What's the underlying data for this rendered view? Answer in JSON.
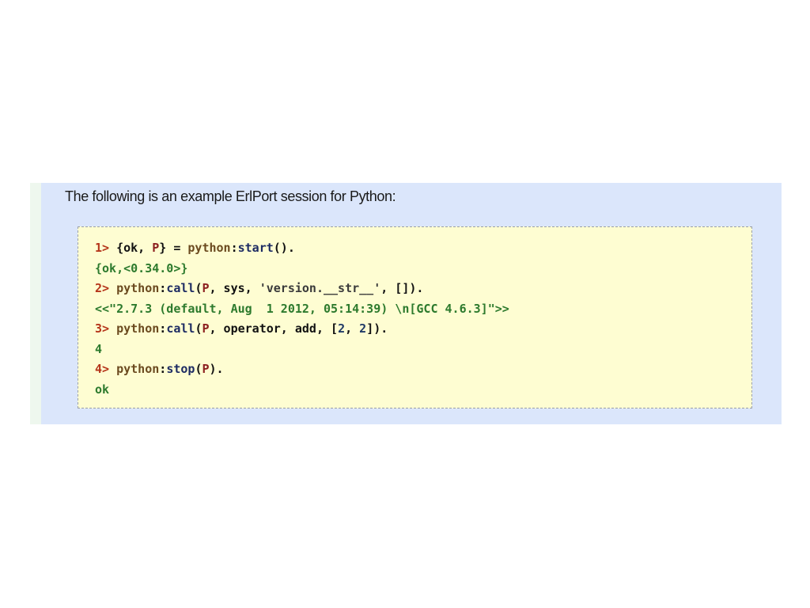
{
  "intro": "The following is an example ErlPort session for Python:",
  "session": {
    "l1": {
      "prompt": "1>",
      "a": "{ok, ",
      "b": "P",
      "c": "} = ",
      "d": "python",
      "e": ":",
      "f": "start",
      "g": "()."
    },
    "o1": "{ok,<0.34.0>}",
    "l2": {
      "prompt": "2>",
      "a": "python",
      "b": ":",
      "c": "call",
      "d": "(",
      "e": "P",
      "f": ", sys, ",
      "g": "'version.__str__'",
      "h": ", []).",
      "i": ""
    },
    "o2": "<<\"2.7.3 (default, Aug  1 2012, 05:14:39) \\n[GCC 4.6.3]\">>",
    "l3": {
      "prompt": "3>",
      "a": "python",
      "b": ":",
      "c": "call",
      "d": "(",
      "e": "P",
      "f": ", operator, add, [",
      "g": "2",
      "h": ", ",
      "i": "2",
      "j": "])."
    },
    "o3": "4",
    "l4": {
      "prompt": "4>",
      "a": "python",
      "b": ":",
      "c": "stop",
      "d": "(",
      "e": "P",
      "f": ")."
    },
    "o4": "ok"
  }
}
